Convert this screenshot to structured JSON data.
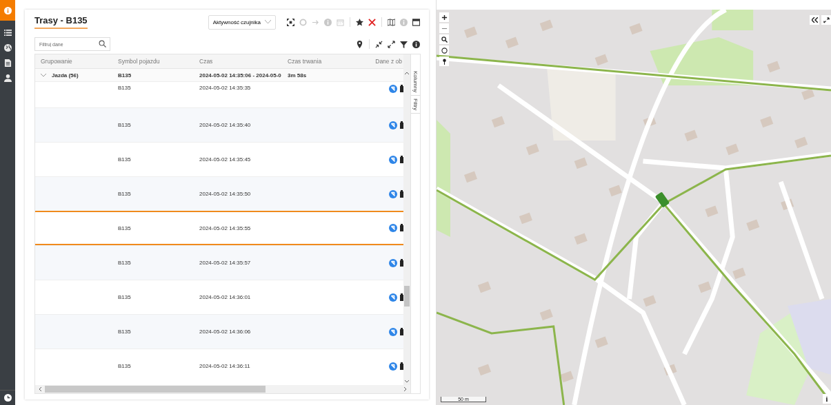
{
  "sidebar": {
    "items": [
      {
        "selected": true
      },
      {
        "selected": false
      },
      {
        "selected": false
      },
      {
        "selected": false
      },
      {
        "selected": false
      }
    ]
  },
  "panel": {
    "title": "Trasy - B135",
    "filter": {
      "placeholder": "Filtruj dane"
    },
    "dropdown": {
      "value": "Aktywność czujnika"
    },
    "toolbar": [
      {
        "kind": "fit",
        "disabled": false
      },
      {
        "kind": "circle",
        "disabled": true
      },
      {
        "kind": "arrow",
        "disabled": true
      },
      {
        "kind": "info",
        "disabled": true
      },
      {
        "kind": "calendar",
        "disabled": true
      },
      {
        "kind": "sep"
      },
      {
        "kind": "star",
        "disabled": false
      },
      {
        "kind": "close",
        "disabled": false
      },
      {
        "kind": "sep"
      },
      {
        "kind": "map",
        "disabled": false
      },
      {
        "kind": "info",
        "disabled": true
      },
      {
        "kind": "window",
        "disabled": false
      }
    ],
    "toolbar2": [
      {
        "kind": "pin"
      },
      {
        "kind": "sep"
      },
      {
        "kind": "collapse"
      },
      {
        "kind": "expand"
      },
      {
        "kind": "filter"
      },
      {
        "kind": "info"
      }
    ]
  },
  "table": {
    "columns": [
      "Grupowanie",
      "Symbol pojazdu",
      "Czas",
      "Czas trwania",
      "Dane z ob"
    ],
    "group": {
      "label": "Jazda (56)",
      "expanded": true,
      "symbol": "B135",
      "time": "2024-05-02 14:35:06 - 2024-05-0",
      "duration": "3m 58s"
    },
    "rows": [
      {
        "symbol": "B135",
        "time": "2024-05-02 14:35:35",
        "selected": false
      },
      {
        "symbol": "B135",
        "time": "2024-05-02 14:35:40",
        "selected": false
      },
      {
        "symbol": "B135",
        "time": "2024-05-02 14:35:45",
        "selected": false
      },
      {
        "symbol": "B135",
        "time": "2024-05-02 14:35:50",
        "selected": false
      },
      {
        "symbol": "B135",
        "time": "2024-05-02 14:35:55",
        "selected": true
      },
      {
        "symbol": "B135",
        "time": "2024-05-02 14:35:57",
        "selected": false
      },
      {
        "symbol": "B135",
        "time": "2024-05-02 14:36:01",
        "selected": false
      },
      {
        "symbol": "B135",
        "time": "2024-05-02 14:36:06",
        "selected": false
      },
      {
        "symbol": "B135",
        "time": "2024-05-02 14:36:11",
        "selected": false
      }
    ],
    "side_tabs": [
      "Kolumny",
      "Filtry"
    ]
  },
  "map": {
    "scale": "50 m",
    "info": "i"
  }
}
